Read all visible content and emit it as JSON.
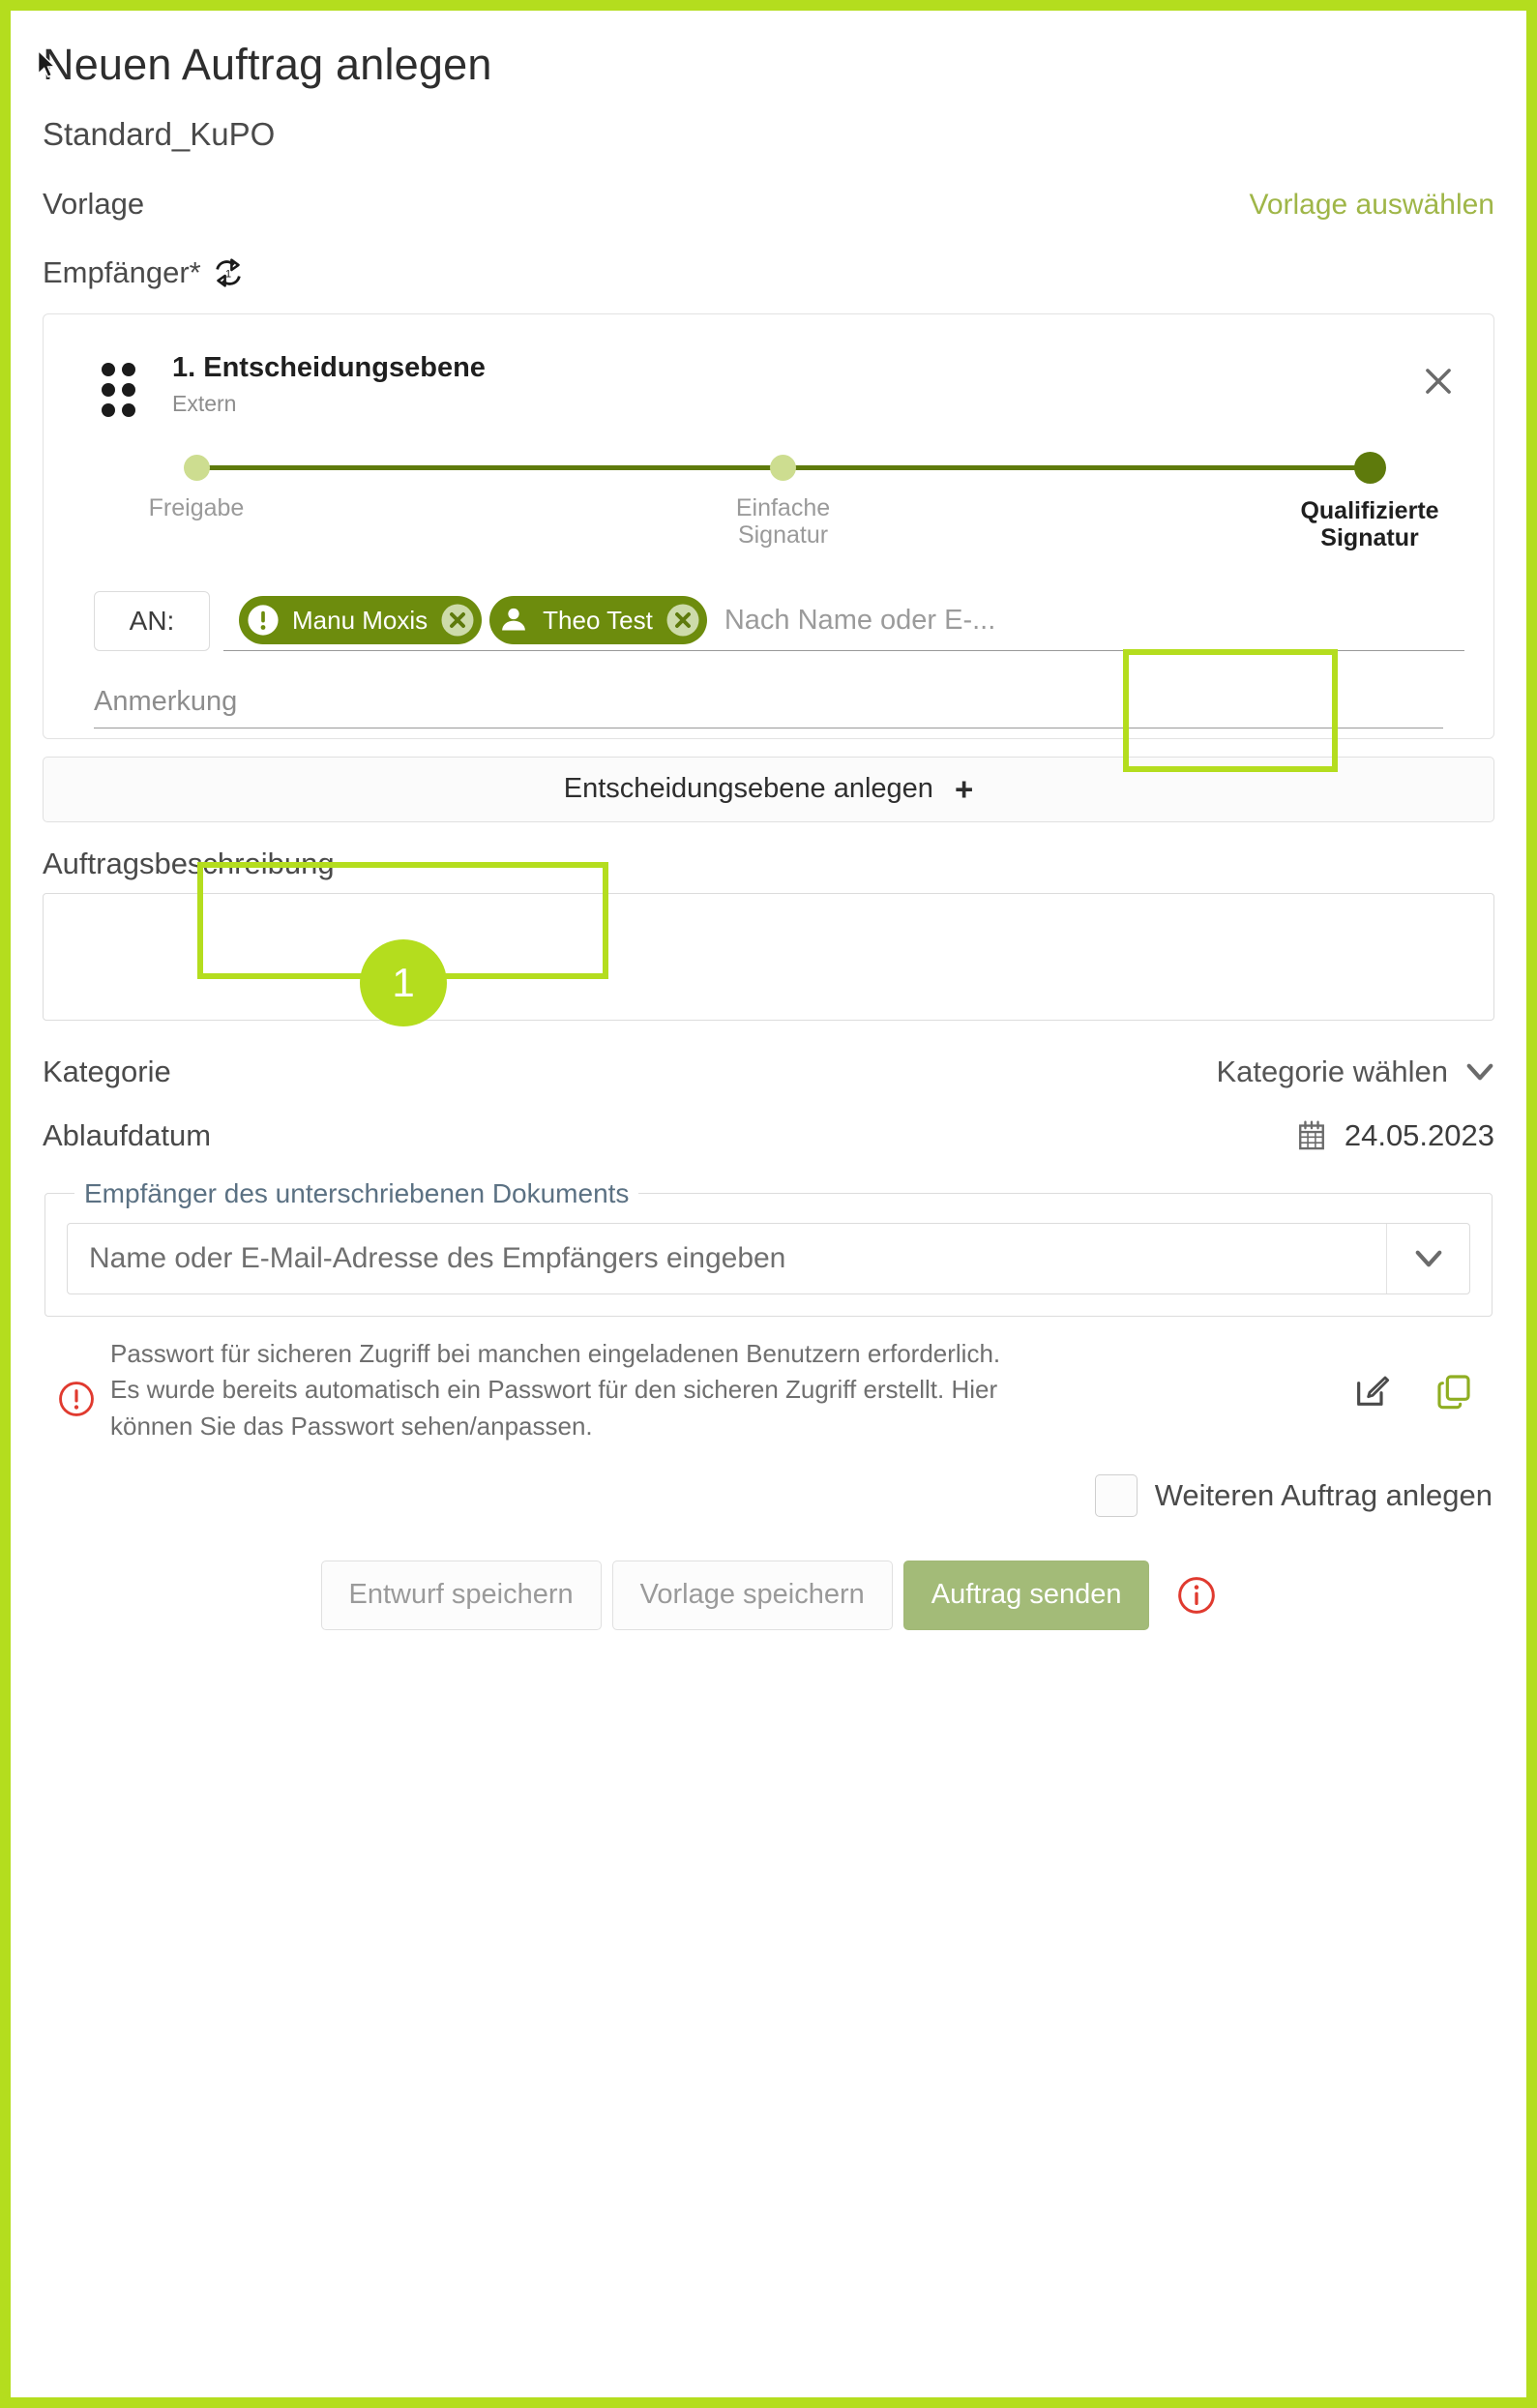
{
  "page": {
    "title": "Neuen Auftrag anlegen",
    "subtitle": "Standard_KuPO",
    "accent_green": "#b4dd1e",
    "dark_green": "#5e7a0c",
    "chip_green": "#6d8c0d",
    "primary_button_green": "#a3bb78",
    "link_green": "#9fb648",
    "warning_red": "#e03a2f"
  },
  "template_row": {
    "label": "Vorlage",
    "action": "Vorlage auswählen"
  },
  "recipients_section": {
    "label": "Empfänger*",
    "sync_icon": "sync-one-icon",
    "sync_icon_badge": "1"
  },
  "decision_level": {
    "drag_handle_icon": "drag-dots-icon",
    "title": "1. Entscheidungsebene",
    "subtitle": "Extern",
    "close_icon": "close-icon",
    "steps": [
      {
        "label": "Freigabe",
        "active": false
      },
      {
        "label": "Einfache\nSignatur",
        "line1": "Einfache",
        "line2": "Signatur",
        "active": false
      },
      {
        "label": "Qualifizierte\nSignatur",
        "line1": "Qualifizierte",
        "line2": "Signatur",
        "active": true
      }
    ],
    "an_label": "AN:",
    "chips": [
      {
        "name": "Manu Moxis",
        "icon": "exclamation-circle-icon",
        "remove_icon": "remove-x-icon"
      },
      {
        "name": "Theo Test",
        "icon": "person-icon",
        "remove_icon": "remove-x-icon"
      }
    ],
    "recipient_input_placeholder": "Nach Name oder E-...",
    "note_label": "Anmerkung",
    "note_value": ""
  },
  "annotation": {
    "badge_number": "1"
  },
  "add_level_button": {
    "label": "Entscheidungsebene anlegen",
    "icon": "plus-icon"
  },
  "description": {
    "label": "Auftragsbeschreibung",
    "value": "",
    "placeholder": ""
  },
  "category": {
    "label": "Kategorie",
    "value": "Kategorie wählen",
    "icon": "chevron-down-icon"
  },
  "expiry": {
    "label": "Ablaufdatum",
    "icon": "calendar-icon",
    "value": "24.05.2023"
  },
  "signed_doc_recipients": {
    "legend": "Empfänger des unterschriebenen Dokuments",
    "select_placeholder": "Name oder E-Mail-Adresse des Empfängers eingeben",
    "select_icon": "chevron-down-icon"
  },
  "password_notice": {
    "warn_icon": "exclamation-circle-outline-icon",
    "line1": "Passwort für sicheren Zugriff bei manchen eingeladenen Benutzern erforderlich.",
    "line2": "Es wurde bereits automatisch ein Passwort für den sicheren Zugriff erstellt. Hier",
    "line3": "können Sie das Passwort sehen/anpassen.",
    "edit_icon": "edit-pencil-icon",
    "copy_icon": "copy-icon"
  },
  "another_order": {
    "label": "Weiteren Auftrag anlegen",
    "checked": false
  },
  "footer": {
    "save_draft": "Entwurf speichern",
    "save_template": "Vorlage speichern",
    "send_order": "Auftrag senden",
    "info_icon": "info-circle-icon"
  }
}
